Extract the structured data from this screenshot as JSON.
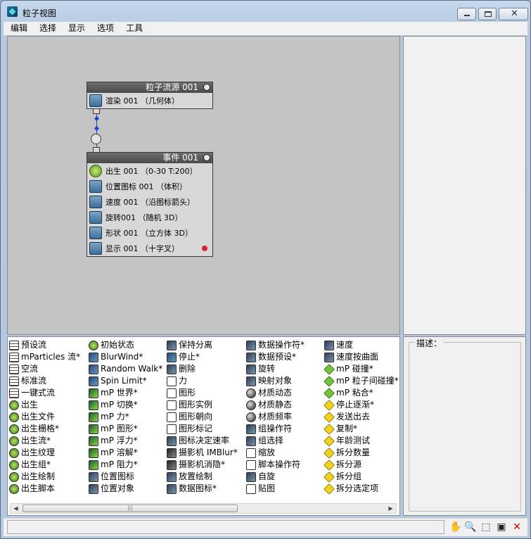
{
  "window": {
    "title": "粒子视图"
  },
  "menu": [
    "编辑",
    "选择",
    "显示",
    "选项",
    "工具"
  ],
  "graph": {
    "source_node": {
      "header": "粒子流源 001",
      "operators": [
        {
          "label": "渲染 001 （几何体）",
          "icon": "render-icon"
        }
      ]
    },
    "event_node": {
      "header": "事件 001",
      "operators": [
        {
          "label": "出生 001 （0-30 T:200）",
          "icon": "birth-icon"
        },
        {
          "label": "位置图标 001 （体积）",
          "icon": "position-icon"
        },
        {
          "label": "速度 001 （沿图标箭头）",
          "icon": "speed-icon"
        },
        {
          "label": "旋转001 （随机 3D）",
          "icon": "rotation-icon"
        },
        {
          "label": "形状 001 （立方体 3D）",
          "icon": "shape-icon"
        },
        {
          "label": "显示 001 （十字叉）",
          "icon": "display-icon",
          "color": "#e01f2f"
        }
      ]
    }
  },
  "description": {
    "label": "描述："
  },
  "depot": {
    "columns": [
      [
        "预设流",
        "mParticles 流*",
        "空流",
        "标准流",
        "一键式流",
        "出生",
        "出生文件",
        "出生栅格*",
        "出生流*",
        "出生纹理",
        "出生组*",
        "出生绘制",
        "出生脚本"
      ],
      [
        "初始状态",
        "BlurWind*",
        "Random Walk*",
        "Spin Limit*",
        "mP 世界*",
        "mP 切换*",
        "mP 力*",
        "mP 图形*",
        "mP 浮力*",
        "mP 溶解*",
        "mP 阻力*",
        "位置图标",
        "位置对象"
      ],
      [
        "保持分离",
        "停止*",
        "删除",
        "力",
        "图形",
        "图形实例",
        "图形朝向",
        "图形标记",
        "图标决定速率",
        "摄影机 IMBlur*",
        "摄影机消隐*",
        "放置绘制",
        "数据图标*"
      ],
      [
        "数据操作符*",
        "数据预设*",
        "旋转",
        "映射对象",
        "材质动态",
        "材质静态",
        "材质频率",
        "组操作符",
        "组选择",
        "缩放",
        "脚本操作符",
        "自旋",
        "贴图"
      ],
      [
        "速度",
        "速度按曲面",
        "mP 碰撞*",
        "mP 粒子间碰撞*",
        "mP 粘合*",
        "停止逐渐*",
        "发送出去",
        "复制*",
        "年龄测试",
        "拆分数量",
        "拆分源",
        "拆分组",
        "拆分选定项"
      ]
    ],
    "column_icons": [
      [
        "flow",
        "flow",
        "flow",
        "flow",
        "flow",
        "birth",
        "birth",
        "birth",
        "birth",
        "birth",
        "birth",
        "birth",
        "birth"
      ],
      [
        "birth",
        "blue",
        "blue",
        "blue",
        "mp",
        "mp",
        "mp",
        "mp",
        "mp",
        "mp",
        "mp",
        "op",
        "op"
      ],
      [
        "op",
        "blue",
        "op",
        "plain",
        "plain",
        "plain",
        "plain",
        "plain",
        "op",
        "cam",
        "cam",
        "op",
        "op"
      ],
      [
        "op",
        "op",
        "op",
        "op",
        "mat",
        "mat",
        "mat",
        "op",
        "op",
        "plain",
        "plain",
        "op",
        "plain"
      ],
      [
        "op",
        "op",
        "green",
        "green",
        "green",
        "test",
        "test",
        "test",
        "test",
        "test",
        "test",
        "test",
        "test"
      ]
    ]
  },
  "status": {
    "value": ""
  }
}
